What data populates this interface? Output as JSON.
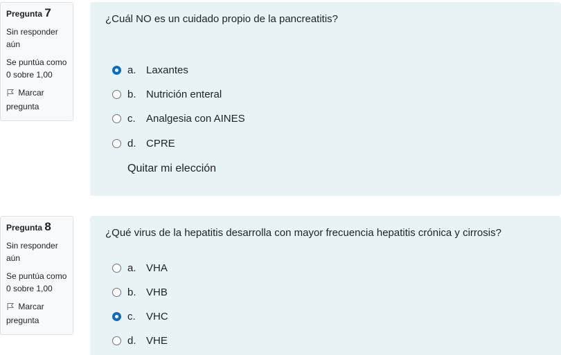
{
  "questions": [
    {
      "label": "Pregunta",
      "number": "7",
      "status_line1": "Sin responder",
      "status_line2": "aún",
      "grade_line1": "Se puntúa como",
      "grade_line2": "0 sobre 1,00",
      "flag_line1": "Marcar",
      "flag_line2": "pregunta",
      "text": "¿Cuál NO es un cuidado propio de la pancreatitis?",
      "options": [
        {
          "letter": "a.",
          "text": "Laxantes",
          "selected": true
        },
        {
          "letter": "b.",
          "text": "Nutrición enteral",
          "selected": false
        },
        {
          "letter": "c.",
          "text": "Analgesia con AINES",
          "selected": false
        },
        {
          "letter": "d.",
          "text": "CPRE",
          "selected": false
        }
      ],
      "clear_label": "Quitar mi elección"
    },
    {
      "label": "Pregunta",
      "number": "8",
      "status_line1": "Sin responder",
      "status_line2": "aún",
      "grade_line1": "Se puntúa como",
      "grade_line2": "0 sobre 1,00",
      "flag_line1": "Marcar",
      "flag_line2": "pregunta",
      "text": "¿Qué virus de la hepatitis desarrolla con mayor frecuencia hepatitis crónica y cirrosis?",
      "options": [
        {
          "letter": "a.",
          "text": "VHA",
          "selected": false
        },
        {
          "letter": "b.",
          "text": "VHB",
          "selected": false
        },
        {
          "letter": "c.",
          "text": "VHC",
          "selected": true
        },
        {
          "letter": "d.",
          "text": "VHE",
          "selected": false
        }
      ]
    }
  ],
  "icons": {
    "flag": "flag-icon",
    "radio": "radio-icon"
  },
  "colors": {
    "content_bg": "#e7f3f5",
    "info_bg": "#f8f9fa",
    "accent": "#0f6cbf"
  }
}
